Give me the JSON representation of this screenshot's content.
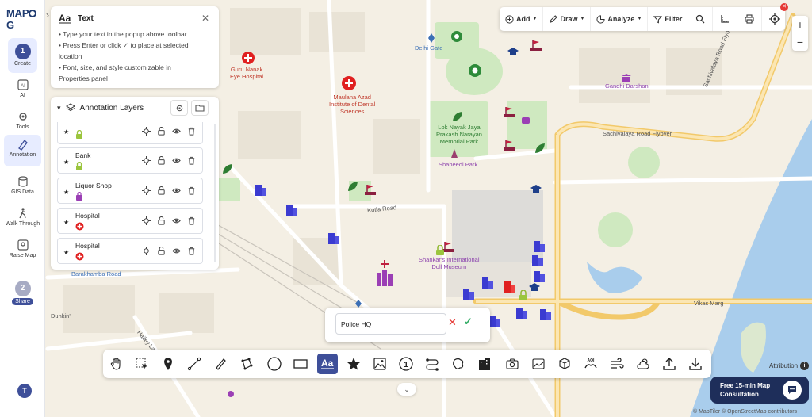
{
  "app": {
    "logo_left": "MAP",
    "logo_right": "G"
  },
  "sidebar": {
    "steps": [
      {
        "num": "1",
        "label": "Create"
      },
      {
        "num": "2",
        "label": "Share"
      }
    ],
    "items": [
      {
        "label": "AI",
        "icon": "ai-icon"
      },
      {
        "label": "Tools",
        "icon": "tools-icon"
      },
      {
        "label": "Annotation",
        "icon": "annotation-icon"
      },
      {
        "label": "GIS Data",
        "icon": "gis-data-icon"
      },
      {
        "label": "Walk Through",
        "icon": "walk-icon"
      },
      {
        "label": "Raise Map",
        "icon": "raise-map-icon"
      }
    ],
    "avatar": "T"
  },
  "text_panel": {
    "title": "Text",
    "instructions": [
      "• Type your text in the popup above toolbar",
      "• Press Enter or click ✓ to place at selected",
      "location",
      "• Font, size, and style customizable in",
      "Properties panel"
    ]
  },
  "layers_panel": {
    "title": "Annotation Layers",
    "rows": [
      {
        "name": "",
        "icon": "lock-icon",
        "color": "#9bc53d"
      },
      {
        "name": "Bank",
        "icon": "lock-icon",
        "color": "#9bc53d"
      },
      {
        "name": "Liquor Shop",
        "icon": "bag-icon",
        "color": "#9b3fb5"
      },
      {
        "name": "Hospital",
        "icon": "cross-icon",
        "color": "#e02020"
      },
      {
        "name": "Hospital",
        "icon": "cross-icon",
        "color": "#e02020"
      }
    ]
  },
  "top_toolbar": {
    "add": "Add",
    "draw": "Draw",
    "analyze": "Analyze",
    "filter": "Filter"
  },
  "popup": {
    "value": "Police HQ"
  },
  "map_labels": {
    "guru_nanak": [
      "Guru Nanak",
      "Eye Hospital"
    ],
    "maulana": [
      "Maulana Azad",
      "Institute of Dental",
      "Sciences"
    ],
    "delhi_gate": "Delhi Gate",
    "lok_nayak": [
      "Lok Nayak Jaya",
      "Prakash Narayan",
      "Memorial Park"
    ],
    "shaheedi": "Shaheedi Park",
    "gandhi": "Gandhi Darshan",
    "sachivalaya": "Sachivalaya Road Flyover",
    "sachivalaya_rd": "Sachivalaya Road Flyover",
    "kotla": "Kotla Road",
    "shankar": [
      "Shankar's International",
      "Doll Museum"
    ],
    "barakhamba": "Barakhamba Road",
    "vikas": "Vikas Marg",
    "dunkin": "Dunkin'",
    "hailey": "Hailey Lane"
  },
  "attribution": "Attribution",
  "consult": [
    "Free 15-min Map",
    "Consultation"
  ],
  "copyright": "© MapTiler © OpenStreetMap contributors",
  "colors": {
    "accent": "#3e4f99",
    "hospital": "#e02020",
    "building": "#3b3bd1",
    "park": "#cfe9c0",
    "water": "#a9cdec",
    "major_road": "#f7d68a"
  }
}
